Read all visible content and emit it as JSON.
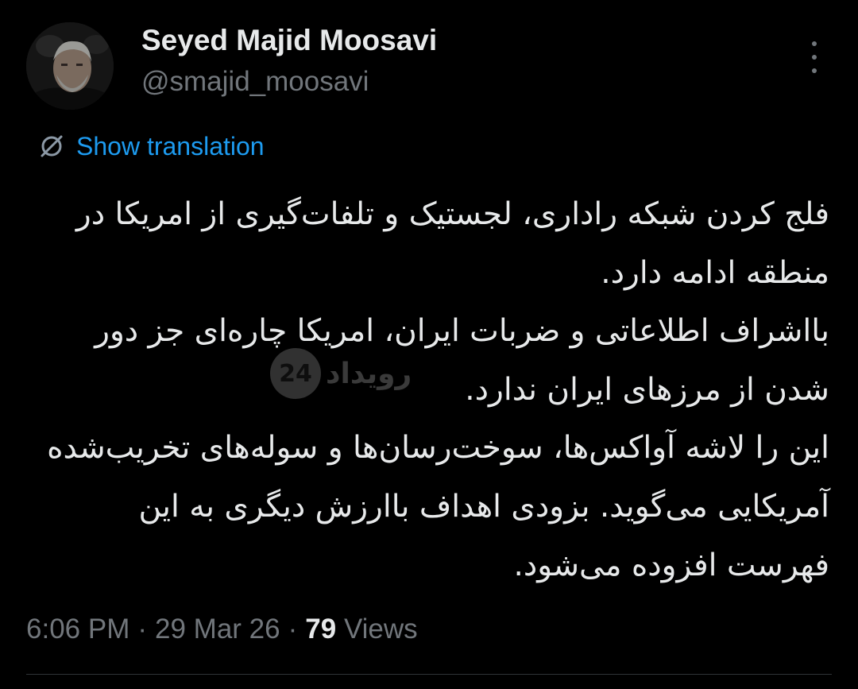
{
  "author": {
    "display_name": "Seyed Majid Moosavi",
    "handle": "@smajid_moosavi",
    "avatar_icon": "profile-photo"
  },
  "actions": {
    "more_icon": "more-vertical-icon",
    "show_translation_label": "Show translation",
    "translate_icon": "translate-icon"
  },
  "tweet": {
    "text": "فلج کردن شبکه راداری، لجستیک و تلفات‌گیری از امریکا در منطقه ادامه دارد.\nبااشراف اطلاعاتی و ضربات ایران، امریکا چاره‌ای جز دور شدن از مرزهای ایران ندارد.\nاین را لاشه آواکس‌ها، سوخت‌رسان‌ها و سوله‌های تخریب‌شده آمریکایی می‌گوید. بزودی اهداف باارزش دیگری به این فهرست افزوده می‌شود."
  },
  "watermark": {
    "badge": "24",
    "text": "رویداد"
  },
  "meta": {
    "time": "6:06 PM",
    "date": "29 Mar 26",
    "separator": "·",
    "views_count": "79",
    "views_label": "Views"
  },
  "colors": {
    "background": "#000000",
    "primary_text": "#e7e9ea",
    "secondary_text": "#71767b",
    "link": "#1d9bf0"
  }
}
